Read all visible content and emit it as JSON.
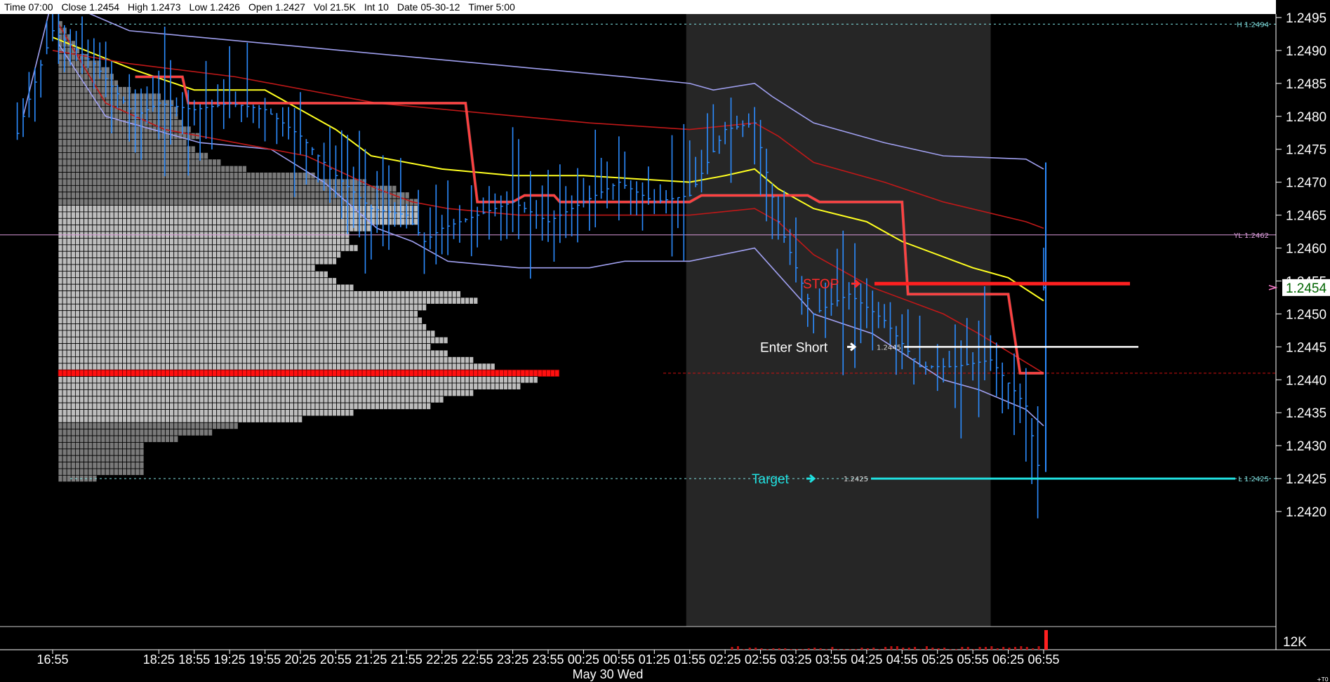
{
  "status": {
    "time": "Time 07:00",
    "close": "Close 1.2454",
    "high": "High 1.2473",
    "low": "Low 1.2426",
    "open": "Open 1.2427",
    "vol": "Vol 21.5K",
    "int": "Int 10",
    "date": "Date 05-30-12",
    "timer": "Timer 5:00"
  },
  "chart_data": {
    "type": "line",
    "title": "",
    "xlabel": "May 30 Wed",
    "ylabel": "",
    "ylim": [
      1.2418,
      1.2497
    ],
    "x_ticks": [
      "16:55",
      "18:25",
      "18:55",
      "19:25",
      "19:55",
      "20:25",
      "20:55",
      "21:25",
      "21:55",
      "22:25",
      "22:55",
      "23:25",
      "23:55",
      "00:25",
      "00:55",
      "01:25",
      "01:55",
      "02:25",
      "02:55",
      "03:25",
      "03:55",
      "04:25",
      "04:55",
      "05:25",
      "05:55",
      "06:25",
      "06:55"
    ],
    "y_ticks": [
      "1.2495",
      "1.2490",
      "1.2485",
      "1.2480",
      "1.2475",
      "1.2470",
      "1.2465",
      "1.2460",
      "1.2455",
      "1.2450",
      "1.2445",
      "1.2440",
      "1.2435",
      "1.2430",
      "1.2425",
      "1.2420"
    ],
    "last_price": "1.2454",
    "volume_axis_label": "12K",
    "volume_corner_label": "+T0",
    "reference_lines": [
      {
        "label": "H 1.2494",
        "value": 1.2494,
        "color": "#7fe0e0"
      },
      {
        "label": "YL 1.2462",
        "value": 1.2462,
        "color": "#e0a0e0"
      },
      {
        "label": "L 1.2425",
        "value": 1.2425,
        "color": "#7fe0e0"
      }
    ],
    "trade_levels": [
      {
        "label": "STOP",
        "price_label": "",
        "value": 1.24546,
        "color": "#ff2020",
        "text_color": "#ff2a2a"
      },
      {
        "label": "Enter Short",
        "price_label": "1.2445",
        "value": 1.2445,
        "color": "#ffffff",
        "text_color": "#ffffff"
      },
      {
        "label": "Target",
        "price_label": "1.2425",
        "value": 1.2425,
        "color": "#20e0e0",
        "text_color": "#20e0e0"
      }
    ],
    "poc_value": 1.2441,
    "session_shading": {
      "start": "01:55",
      "end": "06:00"
    },
    "series": [
      {
        "kind": "upper_band",
        "color": "#a0a0f0",
        "points": [
          [
            "16:30",
            1.248
          ],
          [
            "16:55",
            1.2498
          ],
          [
            "18:00",
            1.2493
          ],
          [
            "19:00",
            1.2492
          ],
          [
            "20:00",
            1.2491
          ],
          [
            "21:00",
            1.249
          ],
          [
            "22:00",
            1.2489
          ],
          [
            "23:00",
            1.2488
          ],
          [
            "00:00",
            1.2487
          ],
          [
            "01:00",
            1.2486
          ],
          [
            "01:55",
            1.2485
          ],
          [
            "02:15",
            1.2484
          ],
          [
            "02:50",
            1.2485
          ],
          [
            "03:05",
            1.2483
          ],
          [
            "03:40",
            1.2479
          ],
          [
            "04:40",
            1.2476
          ],
          [
            "05:30",
            1.2474
          ],
          [
            "06:40",
            1.24735
          ],
          [
            "06:55",
            1.2472
          ]
        ]
      },
      {
        "kind": "lower_band",
        "color": "#a0a0f0",
        "points": [
          [
            "17:00",
            1.2491
          ],
          [
            "17:40",
            1.248
          ],
          [
            "18:20",
            1.2478
          ],
          [
            "19:00",
            1.2476
          ],
          [
            "20:00",
            1.2475
          ],
          [
            "20:45",
            1.247
          ],
          [
            "21:30",
            1.2463
          ],
          [
            "22:00",
            1.2461
          ],
          [
            "22:30",
            1.2458
          ],
          [
            "23:30",
            1.2457
          ],
          [
            "00:30",
            1.2457
          ],
          [
            "01:00",
            1.2458
          ],
          [
            "01:55",
            1.2458
          ],
          [
            "02:50",
            1.246
          ],
          [
            "03:05",
            1.2457
          ],
          [
            "03:40",
            1.245
          ],
          [
            "04:30",
            1.2447
          ],
          [
            "05:30",
            1.244
          ],
          [
            "06:00",
            1.24385
          ],
          [
            "06:40",
            1.24355
          ],
          [
            "06:55",
            1.2433
          ]
        ]
      },
      {
        "kind": "vwap",
        "color": "#ffff20",
        "points": [
          [
            "16:55",
            1.2492
          ],
          [
            "18:05",
            1.2487
          ],
          [
            "18:55",
            1.2484
          ],
          [
            "19:55",
            1.2484
          ],
          [
            "20:25",
            1.2481
          ],
          [
            "20:55",
            1.2478
          ],
          [
            "21:25",
            1.2474
          ],
          [
            "22:25",
            1.2472
          ],
          [
            "23:25",
            1.2471
          ],
          [
            "00:25",
            1.2471
          ],
          [
            "01:55",
            1.247
          ],
          [
            "02:25",
            1.2471
          ],
          [
            "02:50",
            1.2472
          ],
          [
            "03:10",
            1.2469
          ],
          [
            "03:40",
            1.2466
          ],
          [
            "04:25",
            1.2464
          ],
          [
            "04:55",
            1.2461
          ],
          [
            "05:55",
            1.2457
          ],
          [
            "06:25",
            1.24555
          ],
          [
            "06:55",
            1.2452
          ]
        ]
      },
      {
        "kind": "upper_stdev",
        "color": "#c01818",
        "points": [
          [
            "16:55",
            1.249
          ],
          [
            "18:00",
            1.2488
          ],
          [
            "19:30",
            1.2486
          ],
          [
            "20:30",
            1.2484
          ],
          [
            "21:30",
            1.2482
          ],
          [
            "22:30",
            1.2481
          ],
          [
            "23:30",
            1.248
          ],
          [
            "00:30",
            1.2479
          ],
          [
            "01:55",
            1.2478
          ],
          [
            "02:50",
            1.2479
          ],
          [
            "03:10",
            1.2477
          ],
          [
            "03:40",
            1.2473
          ],
          [
            "04:40",
            1.247
          ],
          [
            "05:30",
            1.2467
          ],
          [
            "06:40",
            1.2464
          ],
          [
            "06:55",
            1.2463
          ]
        ]
      },
      {
        "kind": "lower_stdev",
        "color": "#c01818",
        "points": [
          [
            "17:00",
            1.2494
          ],
          [
            "17:40",
            1.2482
          ],
          [
            "18:30",
            1.2478
          ],
          [
            "19:30",
            1.2476
          ],
          [
            "20:30",
            1.2474
          ],
          [
            "21:30",
            1.2469
          ],
          [
            "22:00",
            1.2467
          ],
          [
            "22:30",
            1.2466
          ],
          [
            "23:30",
            1.2465
          ],
          [
            "00:30",
            1.2465
          ],
          [
            "01:55",
            1.2465
          ],
          [
            "02:50",
            1.2466
          ],
          [
            "03:10",
            1.2464
          ],
          [
            "03:40",
            1.2459
          ],
          [
            "04:30",
            1.2454
          ],
          [
            "05:30",
            1.245
          ],
          [
            "06:00",
            1.2447
          ],
          [
            "06:55",
            1.2441
          ]
        ]
      },
      {
        "kind": "pivot",
        "color": "#ff4040",
        "points": [
          [
            "18:05",
            1.2486
          ],
          [
            "18:45",
            1.2486
          ],
          [
            "18:50",
            1.2482
          ],
          [
            "22:45",
            1.2482
          ],
          [
            "22:55",
            1.2467
          ],
          [
            "23:25",
            1.2467
          ],
          [
            "23:35",
            1.2468
          ],
          [
            "00:00",
            1.2468
          ],
          [
            "00:05",
            1.2467
          ],
          [
            "01:55",
            1.2467
          ],
          [
            "02:05",
            1.2468
          ],
          [
            "03:35",
            1.2468
          ],
          [
            "03:45",
            1.2467
          ],
          [
            "04:55",
            1.2467
          ],
          [
            "05:00",
            1.2453
          ],
          [
            "06:25",
            1.2453
          ],
          [
            "06:35",
            1.2441
          ],
          [
            "06:55",
            1.2441
          ]
        ]
      }
    ],
    "profile_volume_bars": "derived",
    "volume": [
      {
        "time": "06:55",
        "value": 12000
      }
    ]
  }
}
